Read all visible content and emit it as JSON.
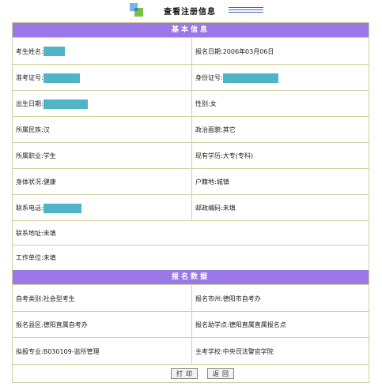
{
  "page": {
    "title": "查看注册信息"
  },
  "sections": {
    "basic": "基本信息",
    "registration": "报名数据"
  },
  "basic": {
    "name_label": "考生姓名:",
    "reg_date_label": "报名日期:",
    "reg_date": "2006年03月06日",
    "ticket_label": "准考证号:",
    "id_label": "身份证号:",
    "birth_label": "出生日期:",
    "gender_label": "性别:",
    "gender": "女",
    "ethnic_label": "所属民族:",
    "ethnic": "汉",
    "political_label": "政治面貌:",
    "political": "其它",
    "job_label": "所属职业:",
    "job": "学生",
    "edu_label": "现有学历:",
    "edu": "大专(专科)",
    "health_label": "身体状况:",
    "health": "健康",
    "hukou_label": "户籍地:",
    "hukou": "城镇",
    "phone_label": "联系电话:",
    "zip_label": "邮政编码:",
    "zip": "未填",
    "address_label": "联系地址:",
    "address": "未填",
    "work_label": "工作单位:",
    "work": "未填"
  },
  "registration": {
    "category_label": "自考类别:",
    "category": "社会型考生",
    "city_label": "报名市州:",
    "city": "德阳市自考办",
    "county_label": "报名县区:",
    "county": "德阳直属自考办",
    "point_label": "报名助学点:",
    "point": "德阳直属直属报名点",
    "major_label": "拟报专业:",
    "major": "B030109-监所管理",
    "school_label": "主考学校:",
    "school": "中央司法警官学院"
  },
  "buttons": {
    "print": "打印",
    "back": "返回"
  },
  "colors": {
    "band": "#9a78e8",
    "mask": "#4fb5c6",
    "border": "#d3cfa0"
  }
}
